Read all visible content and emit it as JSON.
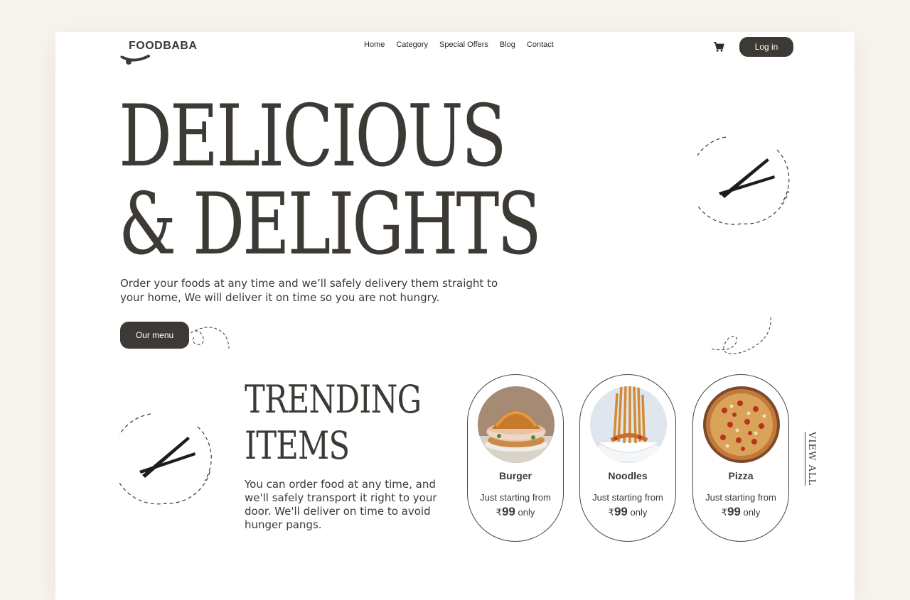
{
  "brand": {
    "name": "FOODBABA"
  },
  "nav": {
    "items": [
      "Home",
      "Category",
      "Special Offers",
      "Blog",
      "Contact"
    ]
  },
  "header": {
    "cart_icon": "cart-icon",
    "login_label": "Log in"
  },
  "hero": {
    "title_line1": "DELICIOUS",
    "title_line2": "& DELIGHTS",
    "subtitle": "Order your foods at any time and we’ll safely delivery them straight to your home, We will deliver it on time so you are not hungry.",
    "menu_button": "Our menu"
  },
  "trending": {
    "title_line1": "TRENDING",
    "title_line2": "ITEMS",
    "description": "You can order food at any time, and we'll safely transport it right to your door. We'll deliver on time to avoid hunger pangs.",
    "view_all": "VIEW ALL",
    "items": [
      {
        "name": "Burger",
        "from": "Just starting from",
        "currency": "₹",
        "price": "99",
        "suffix": "only"
      },
      {
        "name": "Noodles",
        "from": "Just starting from",
        "currency": "₹",
        "price": "99",
        "suffix": "only"
      },
      {
        "name": "Pizza",
        "from": "Just starting from",
        "currency": "₹",
        "price": "99",
        "suffix": "only"
      }
    ]
  },
  "colors": {
    "background": "#f8f5ef",
    "page": "#ffffff",
    "ink": "#3d3935"
  }
}
